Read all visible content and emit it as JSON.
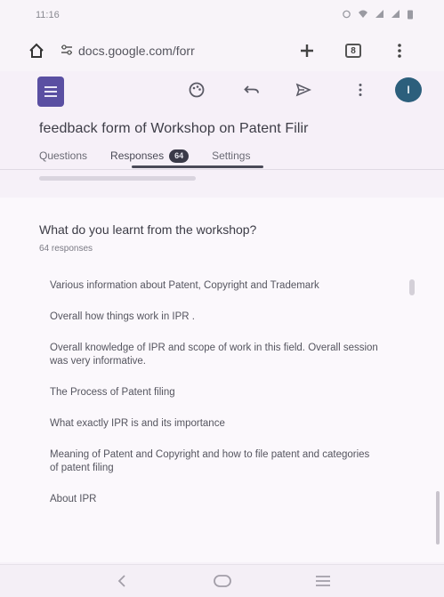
{
  "status_bar": {
    "time": "11:16"
  },
  "browser": {
    "url": "docs.google.com/forr",
    "tabs_count": "8"
  },
  "form": {
    "title": "feedback form of Workshop on Patent Filir",
    "avatar_initial": "I",
    "tabs": [
      {
        "label": "Questions"
      },
      {
        "label": "Responses",
        "badge": "64"
      },
      {
        "label": "Settings"
      }
    ]
  },
  "question": {
    "title": "What do you learnt from the workshop?",
    "responses_count": "64 responses",
    "answers": [
      "Various information about Patent, Copyright and Trademark",
      "Overall how things work in IPR .",
      "Overall knowledge of IPR and scope of work in this field. Overall session was very informative.",
      "The Process of Patent filing",
      "What exactly IPR is and its importance",
      "Meaning of Patent and Copyright and how to file patent and categories of patent filing",
      "About IPR"
    ]
  },
  "icons": {
    "home": "home-icon",
    "site_settings": "tune-icon",
    "new_tab": "plus-icon",
    "tabs": "tabs-icon",
    "menu": "more-vert-icon",
    "palette": "palette-icon",
    "undo": "undo-icon",
    "send": "send-icon",
    "more": "more-vert-icon",
    "nav_back": "back-icon",
    "nav_home": "home-circle-icon",
    "nav_recents": "recents-icon"
  }
}
